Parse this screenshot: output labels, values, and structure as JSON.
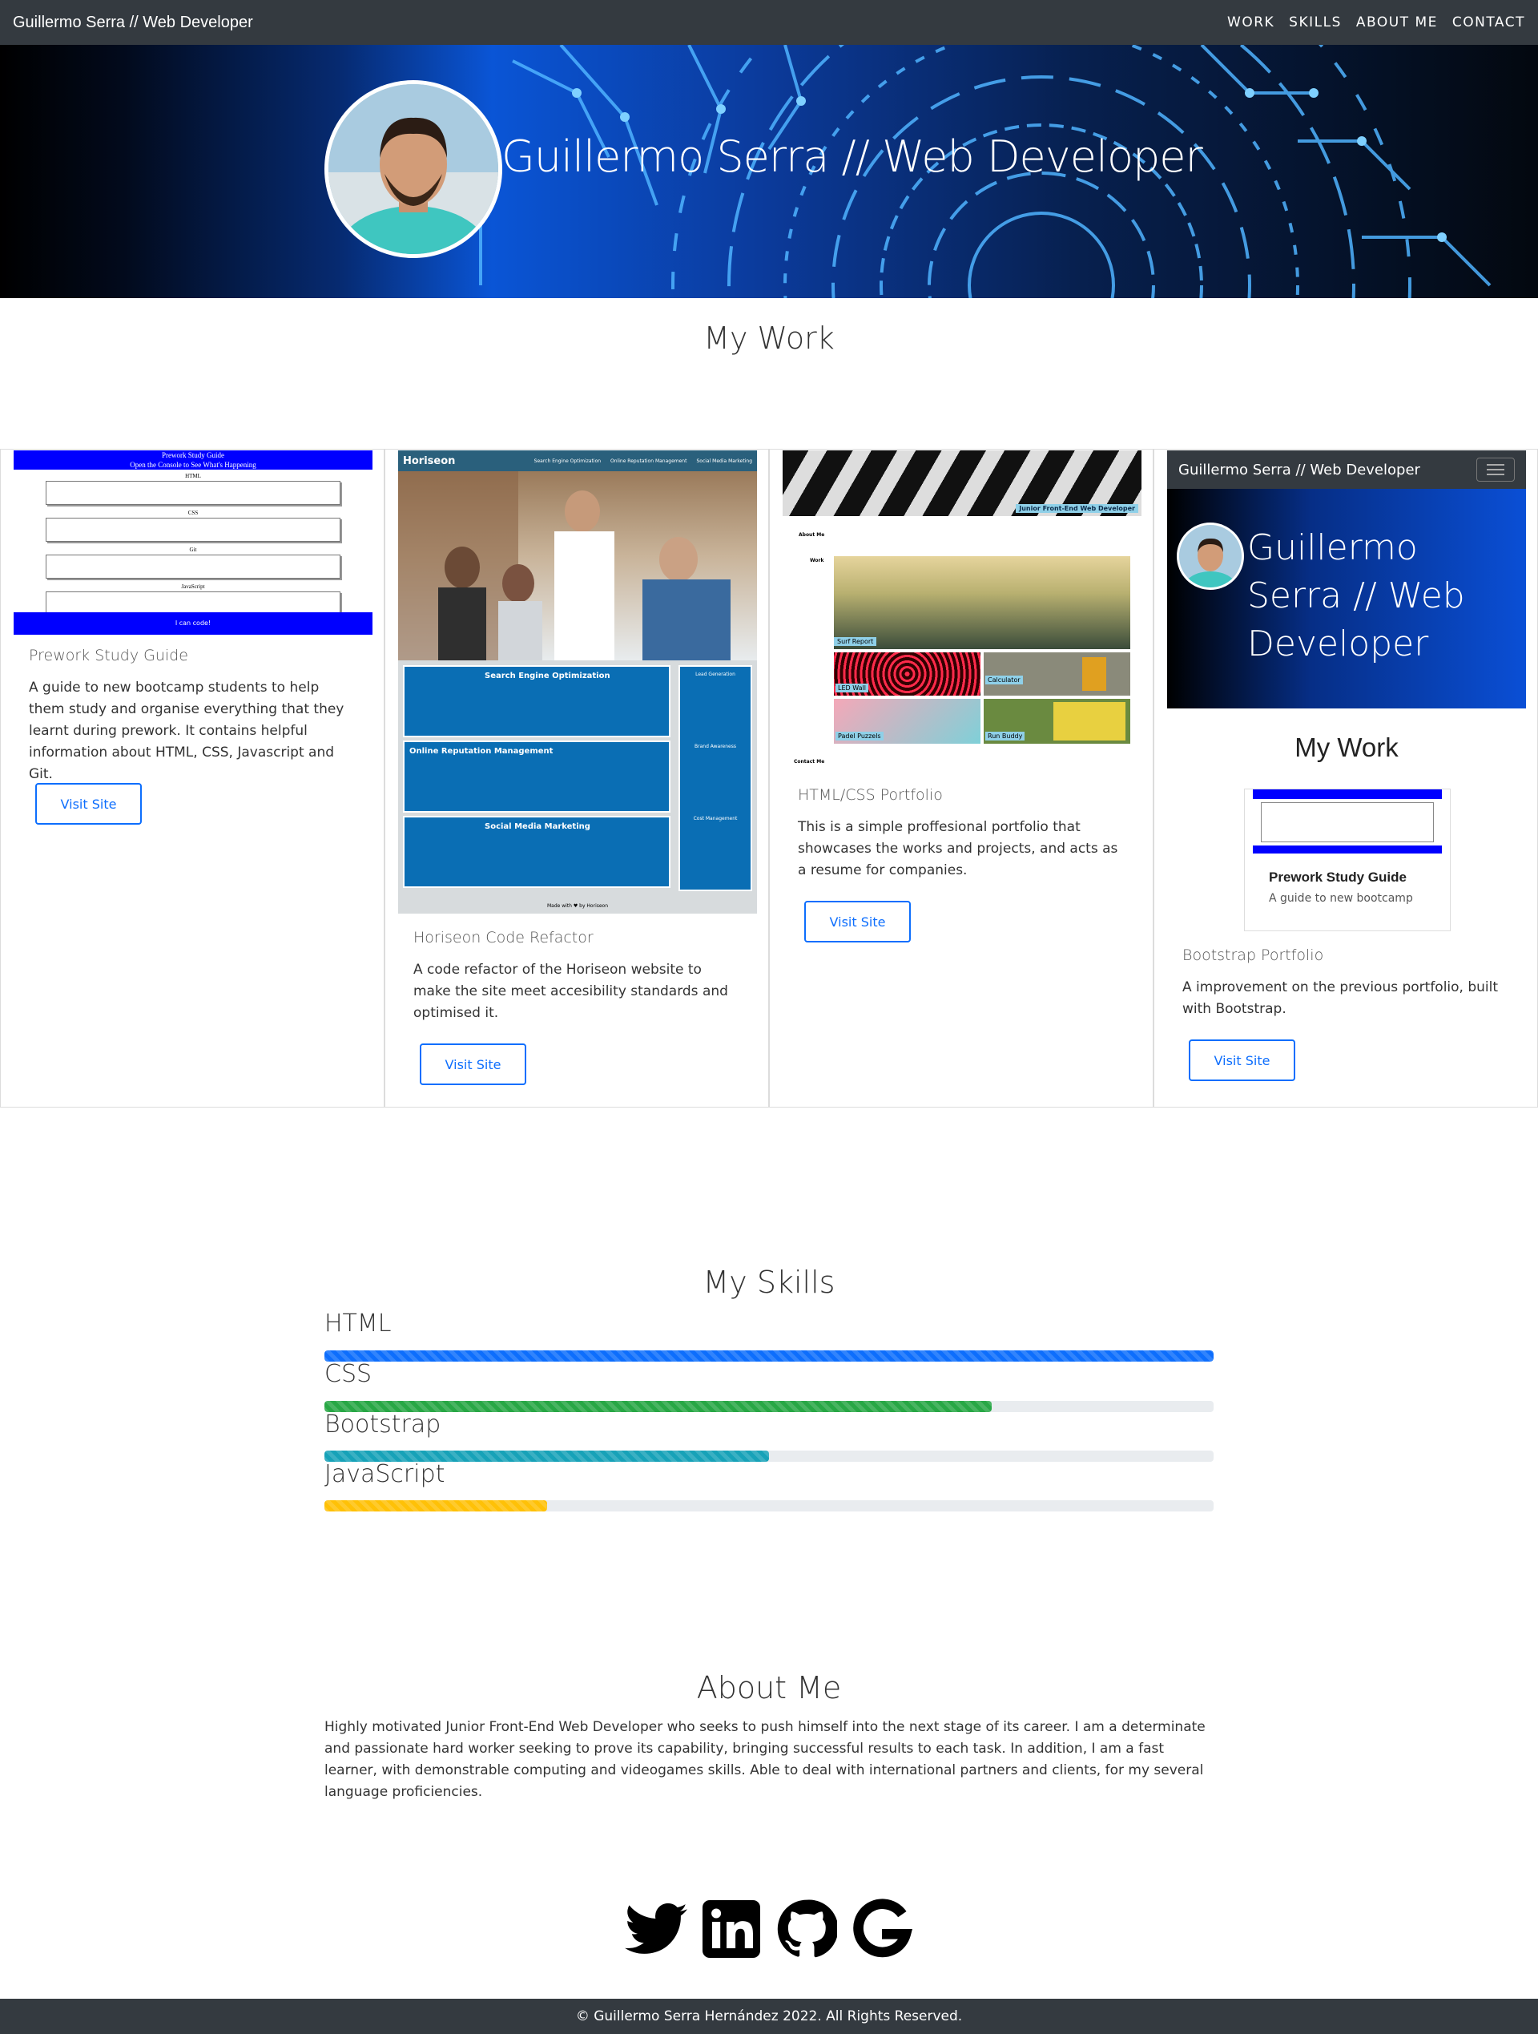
{
  "nav": {
    "brand": "Guillermo Serra // Web Developer",
    "links": [
      "WORK",
      "SKILLS",
      "ABOUT ME",
      "CONTACT"
    ]
  },
  "hero": {
    "title": "Guillermo Serra // Web Developer"
  },
  "work": {
    "title": "My Work",
    "cards": [
      {
        "title": "Prework Study Guide",
        "text": "A guide to new bootcamp students to help them study and organise everything that they learnt during prework. It contains helpful information about HTML, CSS, Javascript and Git.",
        "button": "Visit Site"
      },
      {
        "title": "Horiseon Code Refactor",
        "text": "A code refactor of the Horiseon website to make the site meet accesibility standards and optimised it.",
        "button": "Visit Site"
      },
      {
        "title": "HTML/CSS Portfolio",
        "text": "This is a simple proffesional portfolio that showcases the works and projects, and acts as a resume for companies.",
        "button": "Visit Site"
      },
      {
        "title": "Bootstrap Portfolio",
        "text": "A improvement on the previous portfolio, built with Bootstrap.",
        "button": "Visit Site"
      }
    ],
    "prework_shot": {
      "title": "Prework Study Guide",
      "subtitle": "Open the Console to See What's Happening",
      "sections": [
        "HTML",
        "CSS",
        "Git",
        "JavaScript"
      ],
      "footer": "I can code!"
    },
    "horiseon_shot": {
      "logo": "Horiseon",
      "nav": [
        "Search Engine Optimization",
        "Online Reputation Management",
        "Social Media Marketing"
      ],
      "items": [
        "Search Engine Optimization",
        "Online Reputation Management",
        "Social Media Marketing"
      ],
      "side": [
        "Lead Generation",
        "Brand Awareness",
        "Cost Management"
      ],
      "footer": "Made with ♥ by Horiseon"
    },
    "portfolio_shot": {
      "banner": "Junior Front-End Web Developer",
      "nav_about": "About Me",
      "nav_work": "Work",
      "nav_contact": "Contact Me",
      "tiles": [
        "Surf Report",
        "LED Wall",
        "Calculator",
        "Padel Puzzels",
        "Run Buddy"
      ]
    },
    "bootstrap_shot": {
      "brand": "Guillermo Serra // Web Developer",
      "hero": "Guillermo Serra // Web Developer",
      "heading": "My Work",
      "card_title": "Prework Study Guide",
      "card_text": "A guide to new bootcamp"
    }
  },
  "skills": {
    "title": "My Skills",
    "items": [
      {
        "name": "HTML",
        "level": 1.0,
        "color": "#0d6efd"
      },
      {
        "name": "CSS",
        "level": 0.75,
        "color": "#28a745"
      },
      {
        "name": "Bootstrap",
        "level": 0.5,
        "color": "#17a2b8"
      },
      {
        "name": "JavaScript",
        "level": 0.25,
        "color": "#ffc107"
      }
    ]
  },
  "about": {
    "title": "About Me",
    "text": "Highly motivated Junior Front-End Web Developer who seeks to push himself into the next stage of its career. I am a determinate and passionate hard worker seeking to prove its capability, bringing successful results to each task. In addition, I am a fast learner, with demonstrable computing and videogames skills. Able to deal with international partners and clients, for my several language proficiencies."
  },
  "social": [
    "twitter-icon",
    "linkedin-icon",
    "github-icon",
    "google-icon"
  ],
  "footer": {
    "text": "© Guillermo Serra Hernández 2022. All Rights Reserved."
  }
}
